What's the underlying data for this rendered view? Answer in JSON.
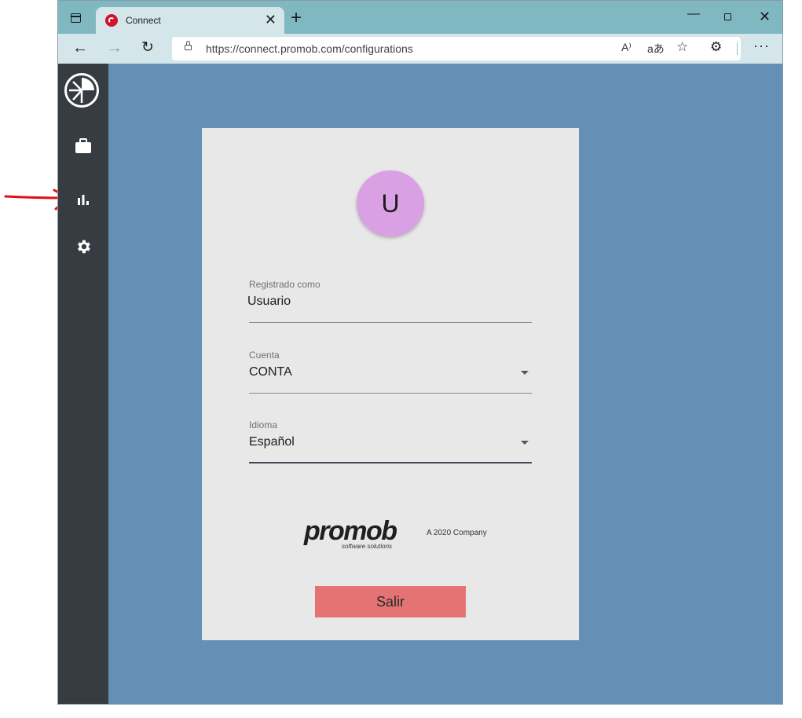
{
  "browser": {
    "tab_title": "Connect",
    "tab_close": "✕",
    "new_tab": "+",
    "url": "https://connect.promob.com/configurations",
    "window_controls": {
      "minimize": "—",
      "close": "✕"
    },
    "nav": {
      "back": "←",
      "forward": "→",
      "refresh": "↻"
    },
    "address_icons": [
      "read-aloud-icon",
      "translate-icon",
      "favorites-icon"
    ],
    "read_aloud_glyph": "A⁾",
    "translate_glyph": "aあ",
    "favorites_glyph": "☆",
    "extensions_glyph": "⚙",
    "more_glyph": "···"
  },
  "sidebar": {
    "items": [
      {
        "name": "briefcase-icon"
      },
      {
        "name": "bar-chart-icon"
      },
      {
        "name": "gear-icon"
      }
    ]
  },
  "profile": {
    "avatar_letter": "U",
    "avatar_color": "#d9a1e4",
    "user": {
      "label": "Registrado como",
      "value": "Usuario"
    },
    "account": {
      "label": "Cuenta",
      "value": "CONTA"
    },
    "language": {
      "label": "Idioma",
      "value": "Español"
    },
    "logout_label": "Salir",
    "logout_color": "#e57373"
  },
  "brand": {
    "wordmark": "promob",
    "tagline": "software solutions",
    "company": "A 2020 Company"
  },
  "colors": {
    "page_bg": "#6590b5",
    "sidebar_bg": "#363c42",
    "card_bg": "#e8e8e8",
    "annotation_arrow": "#e01010"
  }
}
